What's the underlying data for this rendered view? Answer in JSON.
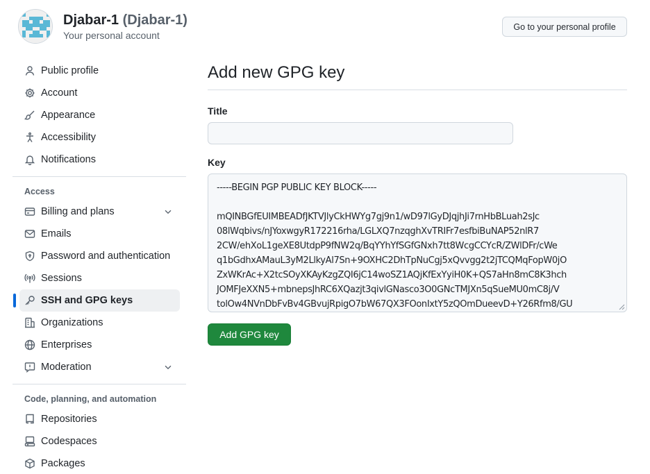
{
  "header": {
    "name": "Djabar-1",
    "login": "(Djabar-1)",
    "subtitle": "Your personal account",
    "profile_button": "Go to your personal profile"
  },
  "sidebar": {
    "top_items": [
      {
        "label": "Public profile",
        "icon": "person-icon"
      },
      {
        "label": "Account",
        "icon": "gear-icon"
      },
      {
        "label": "Appearance",
        "icon": "paintbrush-icon"
      },
      {
        "label": "Accessibility",
        "icon": "accessibility-icon"
      },
      {
        "label": "Notifications",
        "icon": "bell-icon"
      }
    ],
    "access_heading": "Access",
    "access_items": [
      {
        "label": "Billing and plans",
        "icon": "credit-card-icon",
        "expandable": true
      },
      {
        "label": "Emails",
        "icon": "mail-icon"
      },
      {
        "label": "Password and authentication",
        "icon": "shield-lock-icon"
      },
      {
        "label": "Sessions",
        "icon": "broadcast-icon"
      },
      {
        "label": "SSH and GPG keys",
        "icon": "key-icon",
        "active": true
      },
      {
        "label": "Organizations",
        "icon": "organization-icon"
      },
      {
        "label": "Enterprises",
        "icon": "globe-icon"
      },
      {
        "label": "Moderation",
        "icon": "report-icon",
        "expandable": true
      }
    ],
    "code_heading": "Code, planning, and automation",
    "code_items": [
      {
        "label": "Repositories",
        "icon": "repo-icon"
      },
      {
        "label": "Codespaces",
        "icon": "codespaces-icon"
      },
      {
        "label": "Packages",
        "icon": "package-icon"
      }
    ]
  },
  "main": {
    "title": "Add new GPG key",
    "title_label": "Title",
    "title_value": "",
    "key_label": "Key",
    "key_lines": [
      "-----BEGIN PGP PUBLIC KEY BLOCK-----",
      "",
      "mQINBGfEUIMBEADfJKTVJlyCkHWYg7gj9n1/wD97lGyDJqjhJi7rnHbBLuah2sJc",
      "08lWqbivs/nJYoxwgyR172216rha/LGLXQ7nzqghXvTRIFr7esfbiBuNAP52nlR7",
      "2CW/ehXoL1geXE8UtdpP9fNW2q/BqYYhYfSGfGNxh7tt8WcgCCYcR/ZWlDFr/cWe",
      "q1bGdhxAMauL3yM2LlkyAl7Sn+9OXHC2DhTpNuCgj5xQvvgg2t2jTCQMqFopW0jO",
      "ZxWKrAc+X2tcSOyXKAyKzgZQI6jC14woSZ1AQjKfExYyiH0K+QS7aHn8mC8K3hch",
      "JOMFJeXXN5+mbnepsJhRC6XQazjt3qivlGNasco3O0GNcTMJXn5qSueMU0mC8j/V",
      "tolOw4NVnDbFvBv4GBvujRpigO7bW67QX3FOonIxtY5zQOmDueevD+Y26Rfm8/GU"
    ],
    "submit_label": "Add GPG key"
  }
}
